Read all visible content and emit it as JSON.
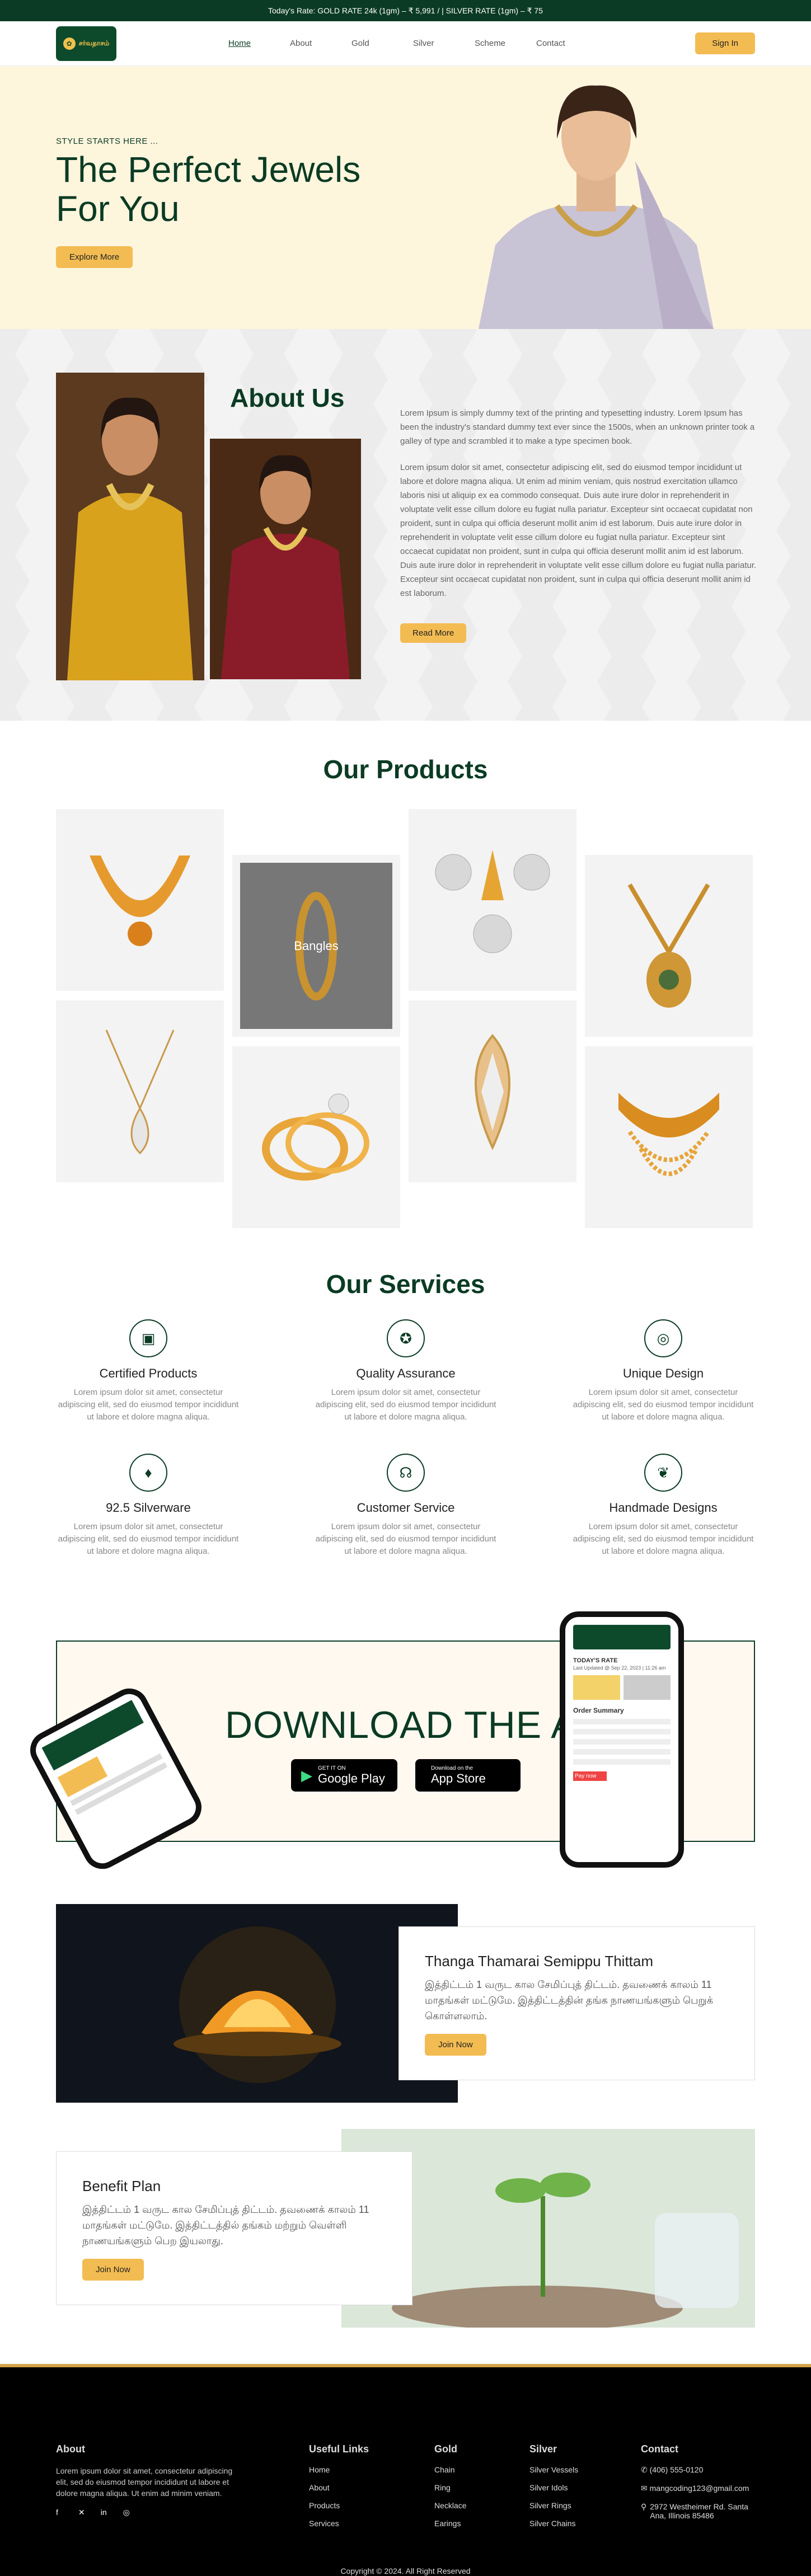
{
  "topbar": {
    "rates": "Today's Rate: GOLD RATE 24k (1gm) – ₹ 5,991 / | SILVER RATE (1gm) – ₹ 75"
  },
  "header": {
    "logo_text": "சர்வதாசம்",
    "nav": [
      "Home",
      "About",
      "Gold",
      "Silver",
      "Scheme",
      "Contact"
    ],
    "signin": "Sign In"
  },
  "hero": {
    "pretitle": "STYLE STARTS HERE ...",
    "title": "The Perfect Jewels For You",
    "button": "Explore More"
  },
  "about": {
    "title": "About Us",
    "p1": "Lorem Ipsum is simply dummy text of the printing and typesetting industry. Lorem Ipsum has been the industry's standard dummy text ever since the 1500s, when an unknown printer took a galley of type and scrambled it to make a type specimen book.",
    "p2": "Lorem ipsum dolor sit amet, consectetur adipiscing elit, sed do eiusmod tempor incididunt ut labore et dolore magna aliqua. Ut enim ad minim veniam, quis nostrud exercitation ullamco laboris nisi ut aliquip ex ea commodo consequat. Duis aute irure dolor in reprehenderit in voluptate velit esse cillum dolore eu fugiat nulla pariatur. Excepteur sint occaecat cupidatat non proident, sunt in culpa qui officia deserunt mollit anim id est laborum. Duis aute irure dolor in reprehenderit in voluptate velit esse cillum dolore eu fugiat nulla pariatur. Excepteur sint occaecat cupidatat non proident, sunt in culpa qui officia deserunt mollit anim id est laborum. Duis aute irure dolor in reprehenderit in voluptate velit esse cillum dolore eu fugiat nulla pariatur. Excepteur sint occaecat cupidatat non proident, sunt in culpa qui officia deserunt mollit anim id est laborum.",
    "button": "Read More"
  },
  "products": {
    "title": "Our Products",
    "hover_caption": "Bangles"
  },
  "services": {
    "title": "Our Services",
    "items": [
      {
        "name": "Certified Products",
        "desc": "Lorem ipsum dolor sit amet, consectetur adipiscing elit, sed do eiusmod tempor incididunt ut labore et dolore magna aliqua."
      },
      {
        "name": "Quality Assurance",
        "desc": "Lorem ipsum dolor sit amet, consectetur adipiscing elit, sed do eiusmod tempor incididunt ut labore et dolore magna aliqua."
      },
      {
        "name": "Unique Design",
        "desc": "Lorem ipsum dolor sit amet, consectetur adipiscing elit, sed do eiusmod tempor incididunt ut labore et dolore magna aliqua."
      },
      {
        "name": "92.5 Silverware",
        "desc": "Lorem ipsum dolor sit amet, consectetur adipiscing elit, sed do eiusmod tempor incididunt ut labore et dolore magna aliqua."
      },
      {
        "name": "Customer Service",
        "desc": "Lorem ipsum dolor sit amet, consectetur adipiscing elit, sed do eiusmod tempor incididunt ut labore et dolore magna aliqua."
      },
      {
        "name": "Handmade Designs",
        "desc": "Lorem ipsum dolor sit amet, consectetur adipiscing elit, sed do eiusmod tempor incididunt ut labore et dolore magna aliqua."
      }
    ]
  },
  "download": {
    "title": "DOWNLOAD THE APP",
    "google": {
      "small": "GET IT ON",
      "big": "Google Play"
    },
    "apple": {
      "small": "Download on the",
      "big": "App Store"
    },
    "phone": {
      "rate_title": "TODAY'S RATE",
      "updated": "Last Updated @ Sep 22, 2023 | 11:26 am",
      "order": "Order Summary",
      "pay": "Pay now"
    }
  },
  "scheme": {
    "title": "Thanga Thamarai Semippu Thittam",
    "text": "இத்திட்டம் 1 வருட கால சேமிப்புத் திட்டம். தவணைக் காலம் 11 மாதங்கள் மட்டுமே. இத்திட்டத்தின் தங்க நாணயங்களும் பெறுக் கொள்ளலாம்.",
    "button": "Join Now"
  },
  "benefit": {
    "title": "Benefit Plan",
    "text": "இத்திட்டம் 1 வருட கால சேமிப்புத் திட்டம். தவணைக் காலம் 11 மாதங்கள் மட்டுமே. இத்திட்டத்தில் தங்கம் மற்றும் வெள்ளி நாணயங்களும் பெற இயலாது.",
    "button": "Join Now"
  },
  "footer": {
    "about_title": "About",
    "about_text": "Lorem ipsum dolor sit amet, consectetur adipiscing elit, sed do eiusmod tempor incididunt ut labore et dolore magna aliqua. Ut enim ad minim veniam.",
    "useful_title": "Useful Links",
    "useful": [
      "Home",
      "About",
      "Products",
      "Services"
    ],
    "gold_title": "Gold",
    "gold": [
      "Chain",
      "Ring",
      "Necklace",
      "Earings"
    ],
    "silver_title": "Silver",
    "silver": [
      "Silver Vessels",
      "Silver Idols",
      "Silver Rings",
      "Silver Chains"
    ],
    "contact_title": "Contact",
    "phone": "(406) 555-0120",
    "email": "mangcoding123@gmail.com",
    "address": "2972 Westheimer Rd. Santa Ana, Illinois 85486",
    "copyright": "Copyright © 2024. All Right Reserved"
  },
  "colors": {
    "primary": "#0b3b24",
    "accent": "#f3bc52",
    "hero_bg": "#fef5dd"
  }
}
